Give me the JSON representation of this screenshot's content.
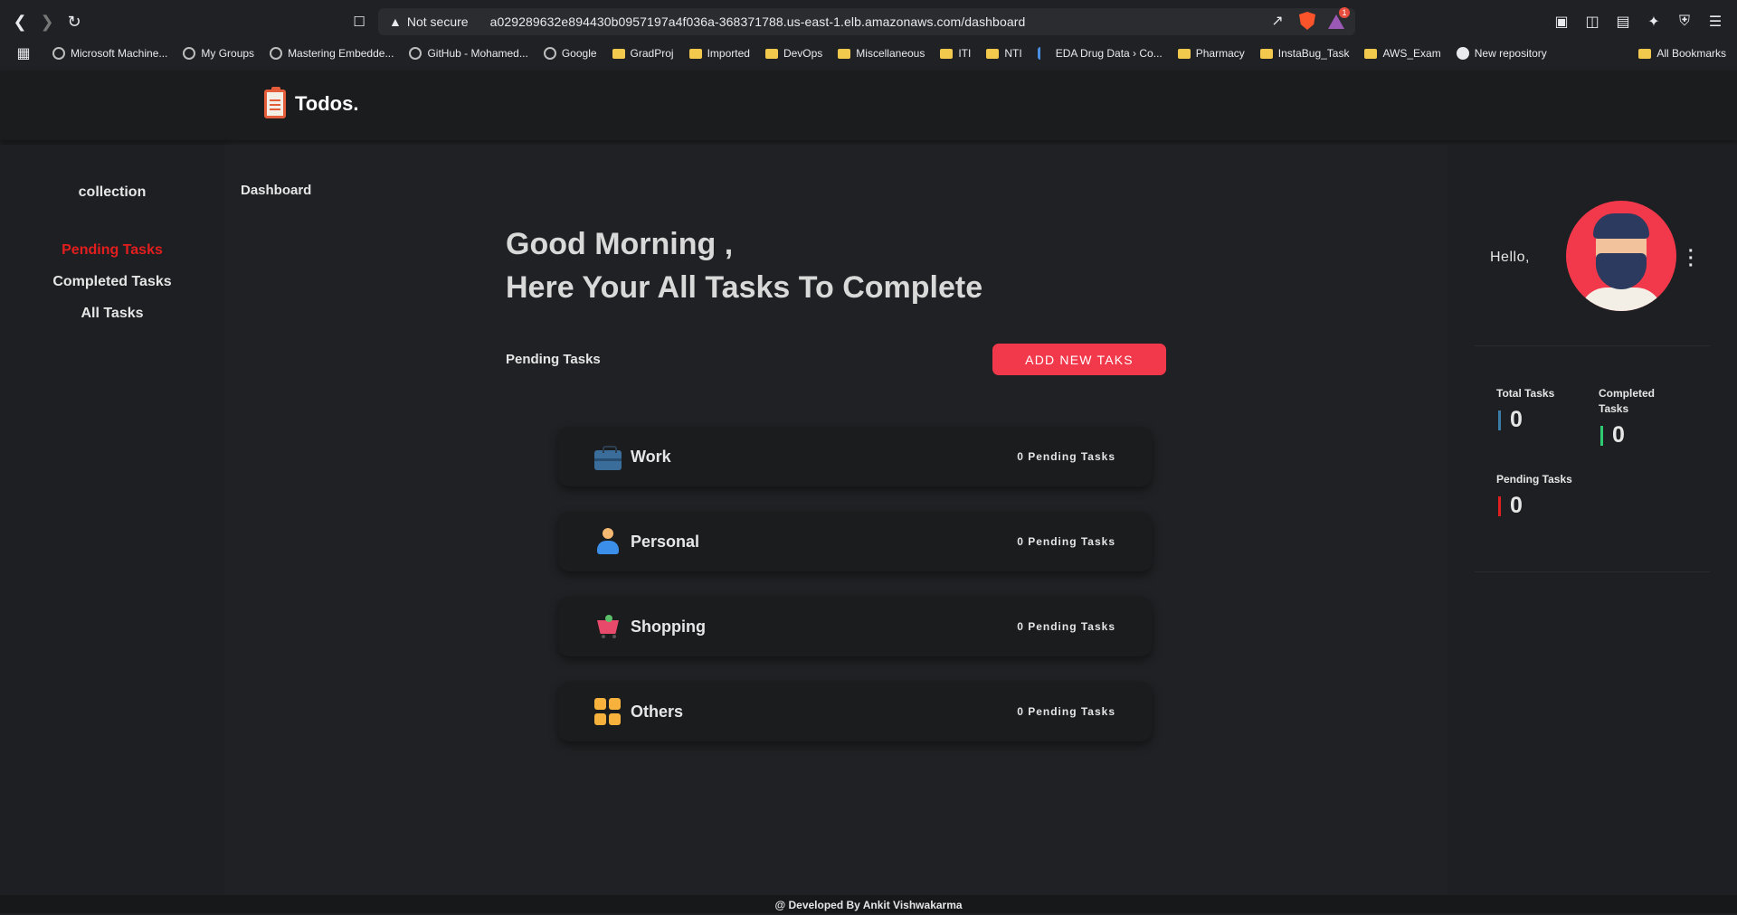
{
  "browser": {
    "security_label": "Not secure",
    "url": "a029289632e894430b0957197a4f036a-368371788.us-east-1.elb.amazonaws.com/dashboard",
    "rewards_badge": "1",
    "bookmarks": [
      {
        "label": "Microsoft Machine...",
        "icon": "globe-icon"
      },
      {
        "label": "My Groups",
        "icon": "globe-icon"
      },
      {
        "label": "Mastering Embedde...",
        "icon": "globe-icon"
      },
      {
        "label": "GitHub - Mohamed...",
        "icon": "globe-icon"
      },
      {
        "label": "Google",
        "icon": "globe-icon"
      },
      {
        "label": "GradProj",
        "icon": "folder-icon"
      },
      {
        "label": "Imported",
        "icon": "folder-icon"
      },
      {
        "label": "DevOps",
        "icon": "folder-icon"
      },
      {
        "label": "Miscellaneous",
        "icon": "folder-icon"
      },
      {
        "label": "ITI",
        "icon": "folder-icon"
      },
      {
        "label": "NTI",
        "icon": "folder-icon"
      },
      {
        "label": "EDA Drug Data › Co...",
        "icon": "eda-icon"
      },
      {
        "label": "Pharmacy",
        "icon": "folder-icon"
      },
      {
        "label": "InstaBug_Task",
        "icon": "folder-icon"
      },
      {
        "label": "AWS_Exam",
        "icon": "folder-icon"
      },
      {
        "label": "New repository",
        "icon": "github-icon"
      }
    ],
    "all_bookmarks": "All Bookmarks"
  },
  "app": {
    "logo_text": "Todos."
  },
  "sidebar": {
    "title": "collection",
    "items": [
      {
        "label": "Pending Tasks",
        "active": true
      },
      {
        "label": "Completed Tasks",
        "active": false
      },
      {
        "label": "All Tasks",
        "active": false
      }
    ]
  },
  "main": {
    "breadcrumb": "Dashboard",
    "greeting_line1": "Good Morning ,",
    "greeting_line2": "Here Your All Tasks To Complete",
    "section_label": "Pending Tasks",
    "add_button": "ADD NEW TAKS",
    "categories": [
      {
        "name": "Work",
        "count": "0 Pending Tasks",
        "icon": "briefcase-icon"
      },
      {
        "name": "Personal",
        "count": "0 Pending Tasks",
        "icon": "person-icon"
      },
      {
        "name": "Shopping",
        "count": "0 Pending Tasks",
        "icon": "cart-icon"
      },
      {
        "name": "Others",
        "count": "0 Pending Tasks",
        "icon": "grid-icon"
      }
    ]
  },
  "profile": {
    "greeting": "Hello,",
    "stats": {
      "total_label": "Total Tasks",
      "total_value": "0",
      "completed_label": "Completed Tasks",
      "completed_value": "0",
      "pending_label": "Pending Tasks",
      "pending_value": "0"
    }
  },
  "footer": {
    "text": "@ Developed By Ankit Vishwakarma"
  },
  "colors": {
    "accent": "#f2394b",
    "active_nav": "#e31e1e",
    "total_bar": "#3a7ca5",
    "completed_bar": "#2ecc71",
    "pending_bar": "#e31e1e"
  }
}
